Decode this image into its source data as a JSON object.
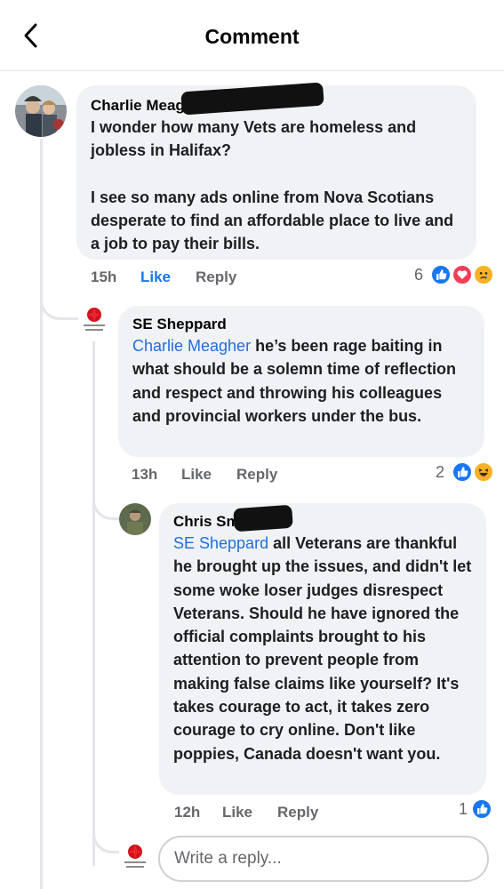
{
  "header": {
    "title": "Comment"
  },
  "colors": {
    "link": "#216fdb",
    "like_active": "#1877f2",
    "muted": "#65676b",
    "bubble": "#f0f2f5",
    "heart": "#f33e58"
  },
  "comments": [
    {
      "author": "Charlie Meagher",
      "text": "I wonder how many Vets are homeless and jobless in Halifax?\n\nI see so many ads online from Nova Scotians desperate to find an affordable place to live and a job to pay their bills.",
      "time": "15h",
      "like_label": "Like",
      "reply_label": "Reply",
      "reaction_count": "6",
      "reactions": [
        "like-icon",
        "love-icon",
        "sad-icon"
      ]
    },
    {
      "author": "SE Sheppard",
      "mention": "Charlie Meagher",
      "text": " he’s been rage baiting in what should be a solemn time of reflection and respect and throwing his colleagues and provincial workers under the bus.",
      "time": "13h",
      "like_label": "Like",
      "reply_label": "Reply",
      "reaction_count": "2",
      "reactions": [
        "like-icon",
        "haha-icon"
      ]
    },
    {
      "author": "Chris Smith",
      "mention": "SE Sheppard",
      "text": " all Veterans are thankful he brought up the issues, and didn't let some woke loser judges disrespect Veterans. Should he have ignored the official complaints brought to his attention to prevent people from making false claims like yourself? It's takes courage to act, it takes zero courage to cry online. Don't like poppies, Canada doesn't want you.",
      "time": "12h",
      "like_label": "Like",
      "reply_label": "Reply",
      "reaction_count": "1",
      "reactions": [
        "like-icon"
      ]
    }
  ],
  "composer": {
    "placeholder": "Write a reply..."
  }
}
